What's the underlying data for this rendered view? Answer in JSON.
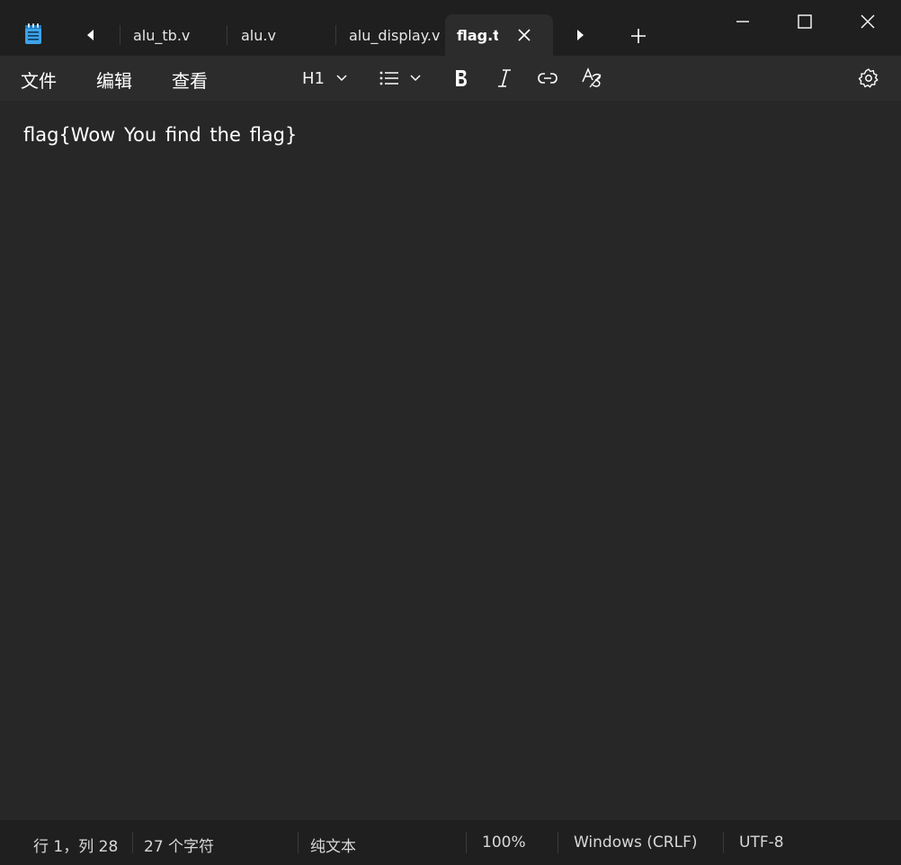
{
  "app": {
    "icon": "notepad-icon",
    "accent": "#3da3e8"
  },
  "tabs": [
    {
      "label": "alu_tb.v",
      "active": false
    },
    {
      "label": "alu.v",
      "active": false
    },
    {
      "label": "alu_display.v",
      "active": false
    },
    {
      "label": "flag.t:",
      "active": true
    }
  ],
  "menu": {
    "file": "文件",
    "edit": "编辑",
    "view": "查看"
  },
  "toolbar": {
    "heading": "H1",
    "icons": [
      "list-icon",
      "bold-icon",
      "italic-icon",
      "link-icon",
      "clear-format-icon",
      "settings-icon"
    ]
  },
  "editor": {
    "content": "flag{Wow You find the flag}"
  },
  "status": {
    "position": "行 1，列 28",
    "char_count": "27 个字符",
    "format": "纯文本",
    "zoom": "100%",
    "line_ending": "Windows (CRLF)",
    "encoding": "UTF-8"
  }
}
